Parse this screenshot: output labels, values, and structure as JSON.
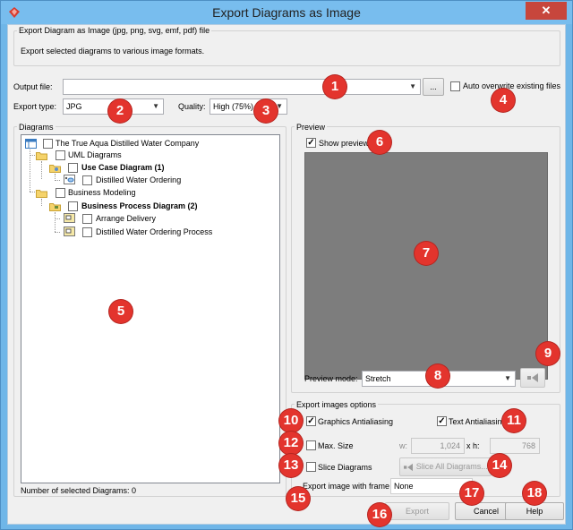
{
  "window": {
    "title": "Export Diagrams as Image",
    "close_symbol": "✕"
  },
  "header": {
    "group_label": "Export Diagram as Image (jpg, png, svg, emf, pdf) file",
    "description": "Export selected diagrams to various image formats."
  },
  "output": {
    "label": "Output file:",
    "value": "",
    "browse_label": "...",
    "auto_overwrite_label": "Auto overwrite existing files",
    "auto_overwrite_checked": false
  },
  "export_type": {
    "label": "Export type:",
    "value": "JPG"
  },
  "quality": {
    "label": "Quality:",
    "value": "High (75%)"
  },
  "diagrams": {
    "group_label": "Diagrams",
    "tree": {
      "root": "The True Aqua Distilled Water Company",
      "uml_folder": "UML Diagrams",
      "use_case_group": "Use Case Diagram (1)",
      "use_case_item": "Distilled Water Ordering",
      "bm_folder": "Business Modeling",
      "bp_group": "Business Process Diagram (2)",
      "bp_item1": "Arrange Delivery",
      "bp_item2": "Distilled Water Ordering Process"
    },
    "count_label": "Number of selected Diagrams: 0"
  },
  "preview": {
    "group_label": "Preview",
    "show_preview_label": "Show preview",
    "show_preview_checked": true,
    "mode_label": "Preview mode:",
    "mode_value": "Stretch"
  },
  "options": {
    "group_label": "Export images options",
    "graphics_aa_label": "Graphics Antialiasing",
    "graphics_aa_checked": true,
    "text_aa_label": "Text Antialiasing",
    "text_aa_checked": true,
    "max_size_label": "Max. Size",
    "max_size_checked": false,
    "w_label": "w:",
    "w_value": "1,024",
    "h_label": "x h:",
    "h_value": "768",
    "slice_label": "Slice Diagrams",
    "slice_checked": false,
    "slice_all_label": "Slice All Diagrams...",
    "frame_label": "Export image with frame :",
    "frame_value": "None"
  },
  "footer": {
    "export_label": "Export",
    "cancel_label": "Cancel",
    "help_label": "Help"
  },
  "badges": [
    "1",
    "2",
    "3",
    "4",
    "5",
    "6",
    "7",
    "8",
    "9",
    "10",
    "11",
    "12",
    "13",
    "14",
    "15",
    "16",
    "17",
    "18"
  ],
  "colors": {
    "badge": "#e3342d",
    "titlebar": "#78bdee",
    "preview_bg": "#7d7d7d",
    "close": "#c7463c"
  }
}
